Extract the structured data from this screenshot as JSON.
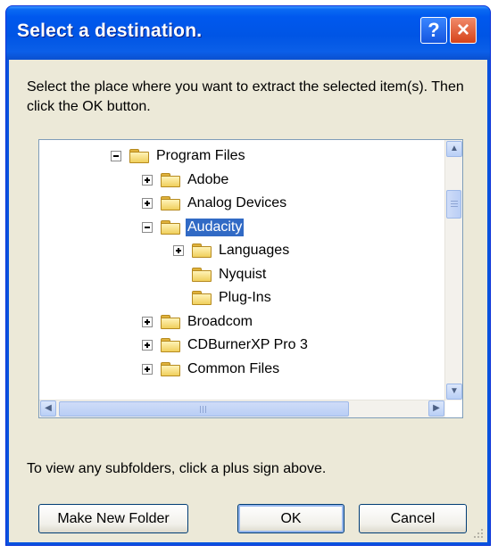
{
  "dialog": {
    "title": "Select a destination.",
    "help_glyph": "?",
    "close_glyph": "×",
    "description": "Select the place where you want to extract the selected item(s).  Then click the OK button.",
    "hint": "To view any subfolders, click a plus sign above."
  },
  "tree": {
    "items": [
      {
        "label": "Program Files",
        "expander": "minus",
        "level": 0
      },
      {
        "label": "Adobe",
        "expander": "plus",
        "level": 1
      },
      {
        "label": "Analog Devices",
        "expander": "plus",
        "level": 1
      },
      {
        "label": "Audacity",
        "expander": "minus",
        "level": 1,
        "selected": true
      },
      {
        "label": "Languages",
        "expander": "plus",
        "level": 2
      },
      {
        "label": "Nyquist",
        "expander": "none",
        "level": 2
      },
      {
        "label": "Plug-Ins",
        "expander": "none",
        "level": 2
      },
      {
        "label": "Broadcom",
        "expander": "plus",
        "level": 1
      },
      {
        "label": "CDBurnerXP Pro 3",
        "expander": "plus",
        "level": 1
      },
      {
        "label": "Common Files",
        "expander": "plus",
        "level": 1
      }
    ]
  },
  "scroll": {
    "up": "▲",
    "down": "▼",
    "left": "◀",
    "right": "▶"
  },
  "buttons": {
    "make_new_folder": "Make New Folder",
    "ok": "OK",
    "cancel": "Cancel"
  },
  "colors": {
    "titlebar": "#0055e5",
    "selection": "#316ac5",
    "client": "#ece9d8"
  }
}
